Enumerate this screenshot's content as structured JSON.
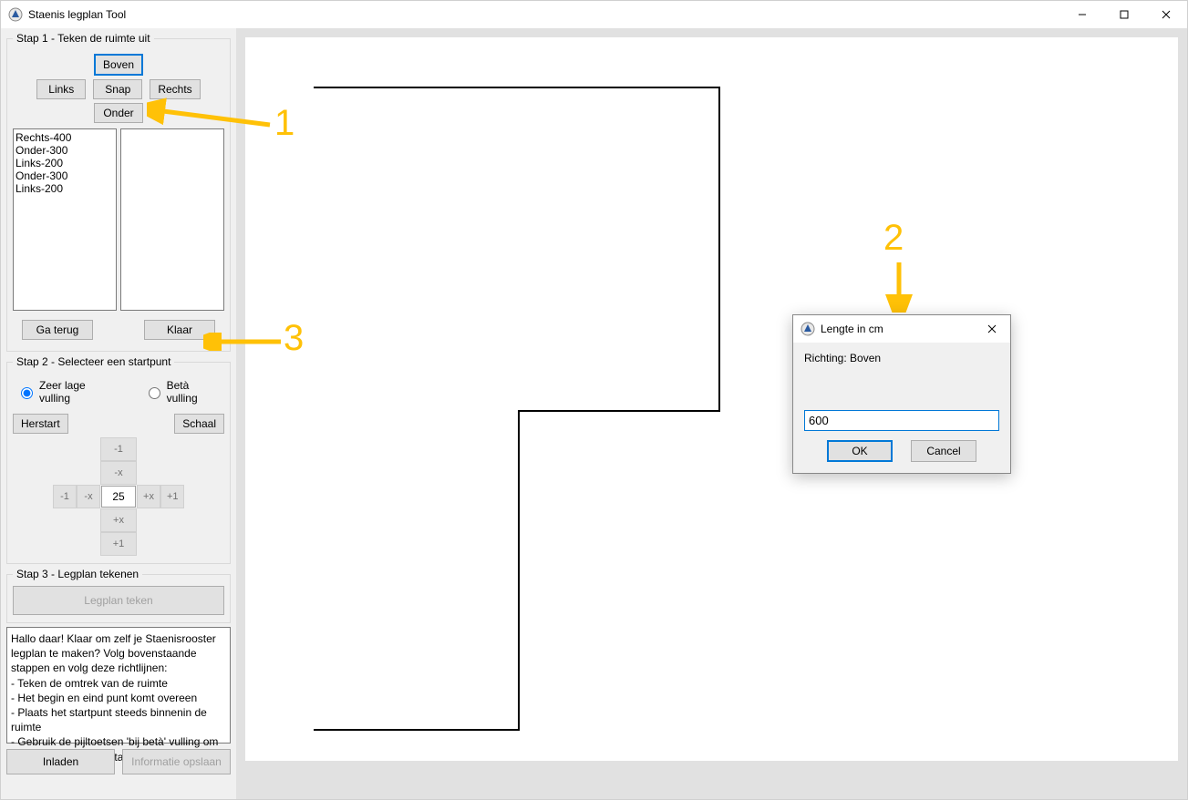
{
  "window": {
    "title": "Staenis legplan Tool",
    "controls": {
      "min": "–",
      "max": "▢",
      "close": "✕"
    }
  },
  "step1": {
    "legend": "Stap 1 - Teken de ruimte uit",
    "boven": "Boven",
    "links": "Links",
    "snap": "Snap",
    "rechts": "Rechts",
    "onder": "Onder",
    "list": [
      "Rechts-400",
      "Onder-300",
      "Links-200",
      "Onder-300",
      "Links-200"
    ],
    "ga_terug": "Ga terug",
    "klaar": "Klaar"
  },
  "step2": {
    "legend": "Stap 2 - Selecteer een startpunt",
    "radio_low": "Zeer lage vulling",
    "radio_beta": "Betà vulling",
    "herstart": "Herstart",
    "schaal": "Schaal",
    "minus1_top": "-1",
    "minusx_top": "-x",
    "minus1_left": "-1",
    "minusx_left": "-x",
    "value": "25",
    "plusx_right": "+x",
    "plus1_right": "+1",
    "plusx_bottom": "+x",
    "plus1_bottom": "+1"
  },
  "step3": {
    "legend": "Stap 3 - Legplan tekenen",
    "legplan_teken": "Legplan teken"
  },
  "info": {
    "text": "Hallo daar! Klaar om zelf je Staenisrooster legplan te maken? Volg bovenstaande stappen en volg deze richtlijnen:\n- Teken de omtrek van de ruimte\n- Het begin en eind punt komt overeen\n- Plaats het startpunt steeds binnenin de ruimte\n- Gebruik de pijltoetsen 'bij betà' vulling om verder, terug of een stap over te slaan"
  },
  "bottom": {
    "inladen": "Inladen",
    "info_opslaan": "Informatie opslaan"
  },
  "dialog": {
    "title": "Lengte in cm",
    "richting_label": "Richting: Boven",
    "value": "600",
    "ok": "OK",
    "cancel": "Cancel"
  },
  "annotations": {
    "one": "1",
    "two": "2",
    "three": "3"
  }
}
